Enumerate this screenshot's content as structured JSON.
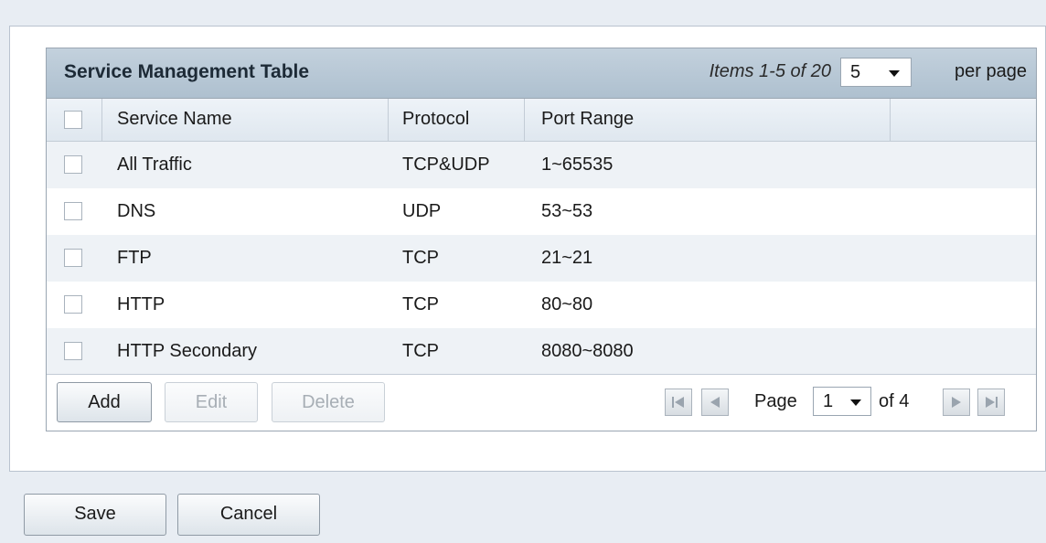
{
  "table": {
    "title": "Service Management Table",
    "items_info": "Items 1-5 of 20",
    "per_page_value": "5",
    "per_page_label": "per page",
    "columns": [
      "Service Name",
      "Protocol",
      "Port Range"
    ],
    "rows": [
      {
        "name": "All Traffic",
        "protocol": "TCP&UDP",
        "port_range": "1~65535"
      },
      {
        "name": "DNS",
        "protocol": "UDP",
        "port_range": "53~53"
      },
      {
        "name": "FTP",
        "protocol": "TCP",
        "port_range": "21~21"
      },
      {
        "name": "HTTP",
        "protocol": "TCP",
        "port_range": "80~80"
      },
      {
        "name": "HTTP Secondary",
        "protocol": "TCP",
        "port_range": "8080~8080"
      }
    ]
  },
  "footer": {
    "add_label": "Add",
    "edit_label": "Edit",
    "delete_label": "Delete",
    "page_label": "Page",
    "page_value": "1",
    "of_label": "of 4"
  },
  "actions": {
    "save_label": "Save",
    "cancel_label": "Cancel"
  },
  "icons": {
    "first_page": "first-page-icon",
    "prev_page": "previous-page-icon",
    "next_page": "next-page-icon",
    "last_page": "last-page-icon"
  }
}
